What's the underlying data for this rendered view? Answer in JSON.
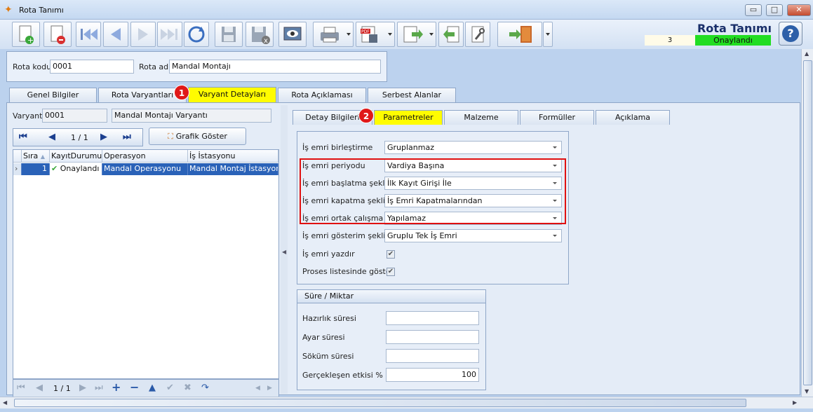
{
  "window": {
    "title": "Rota Tanımı",
    "minimize": "▭",
    "maximize": "□",
    "close": "✕"
  },
  "header": {
    "title": "Rota Tanımı",
    "record_number": "3",
    "status": "Onaylandı"
  },
  "form": {
    "rota_kodu_label": "Rota kodu",
    "rota_kodu_value": "0001",
    "rota_adi_label": "Rota adı",
    "rota_adi_value": "Mandal Montajı"
  },
  "tabs": [
    "Genel Bilgiler",
    "Rota Varyantları",
    "Varyant Detayları",
    "Rota Açıklaması",
    "Serbest Alanlar"
  ],
  "badges": [
    "1",
    "2"
  ],
  "variant": {
    "label": "Varyant",
    "code": "0001",
    "name": "Mandal Montajı Varyantı",
    "pager": "1 / 1",
    "chart_button": "Grafik Göster"
  },
  "grid": {
    "columns": [
      "Sıra",
      "KayıtDurumu",
      "Operasyon",
      "İş İstasyonu"
    ],
    "rows": [
      {
        "sira": "1",
        "durum": "Onaylandı",
        "operasyon": "Mandal Operasyonu",
        "istasyon": "Mandal Montaj İstasyonu"
      }
    ],
    "pager": "1 / 1"
  },
  "subtabs": [
    "Detay Bilgileri",
    "Parametreler",
    "Malzeme",
    "Formüller",
    "Açıklama"
  ],
  "parameters": [
    {
      "label": "İş emri birleştirme",
      "value": "Gruplanmaz"
    },
    {
      "label": "İş emri periyodu",
      "value": "Vardiya Başına"
    },
    {
      "label": "İş emri başlatma şekli",
      "value": "İlk Kayıt Girişi İle"
    },
    {
      "label": "İş emri kapatma şekli",
      "value": "İş Emri Kapatmalarından"
    },
    {
      "label": "İş emri ortak çalışma",
      "value": "Yapılamaz"
    },
    {
      "label": "İş emri gösterim şekli",
      "value": "Gruplu Tek İş Emri"
    },
    {
      "label": "İş emri yazdır",
      "checked": true
    },
    {
      "label": "Proses listesinde göster",
      "checked": true
    }
  ],
  "sure_miktar": {
    "title": "Süre / Miktar",
    "fields": [
      {
        "label": "Hazırlık süresi",
        "value": ""
      },
      {
        "label": "Ayar süresi",
        "value": ""
      },
      {
        "label": "Söküm süresi",
        "value": ""
      },
      {
        "label": "Gerçekleşen etkisi %",
        "value": "100"
      }
    ]
  }
}
